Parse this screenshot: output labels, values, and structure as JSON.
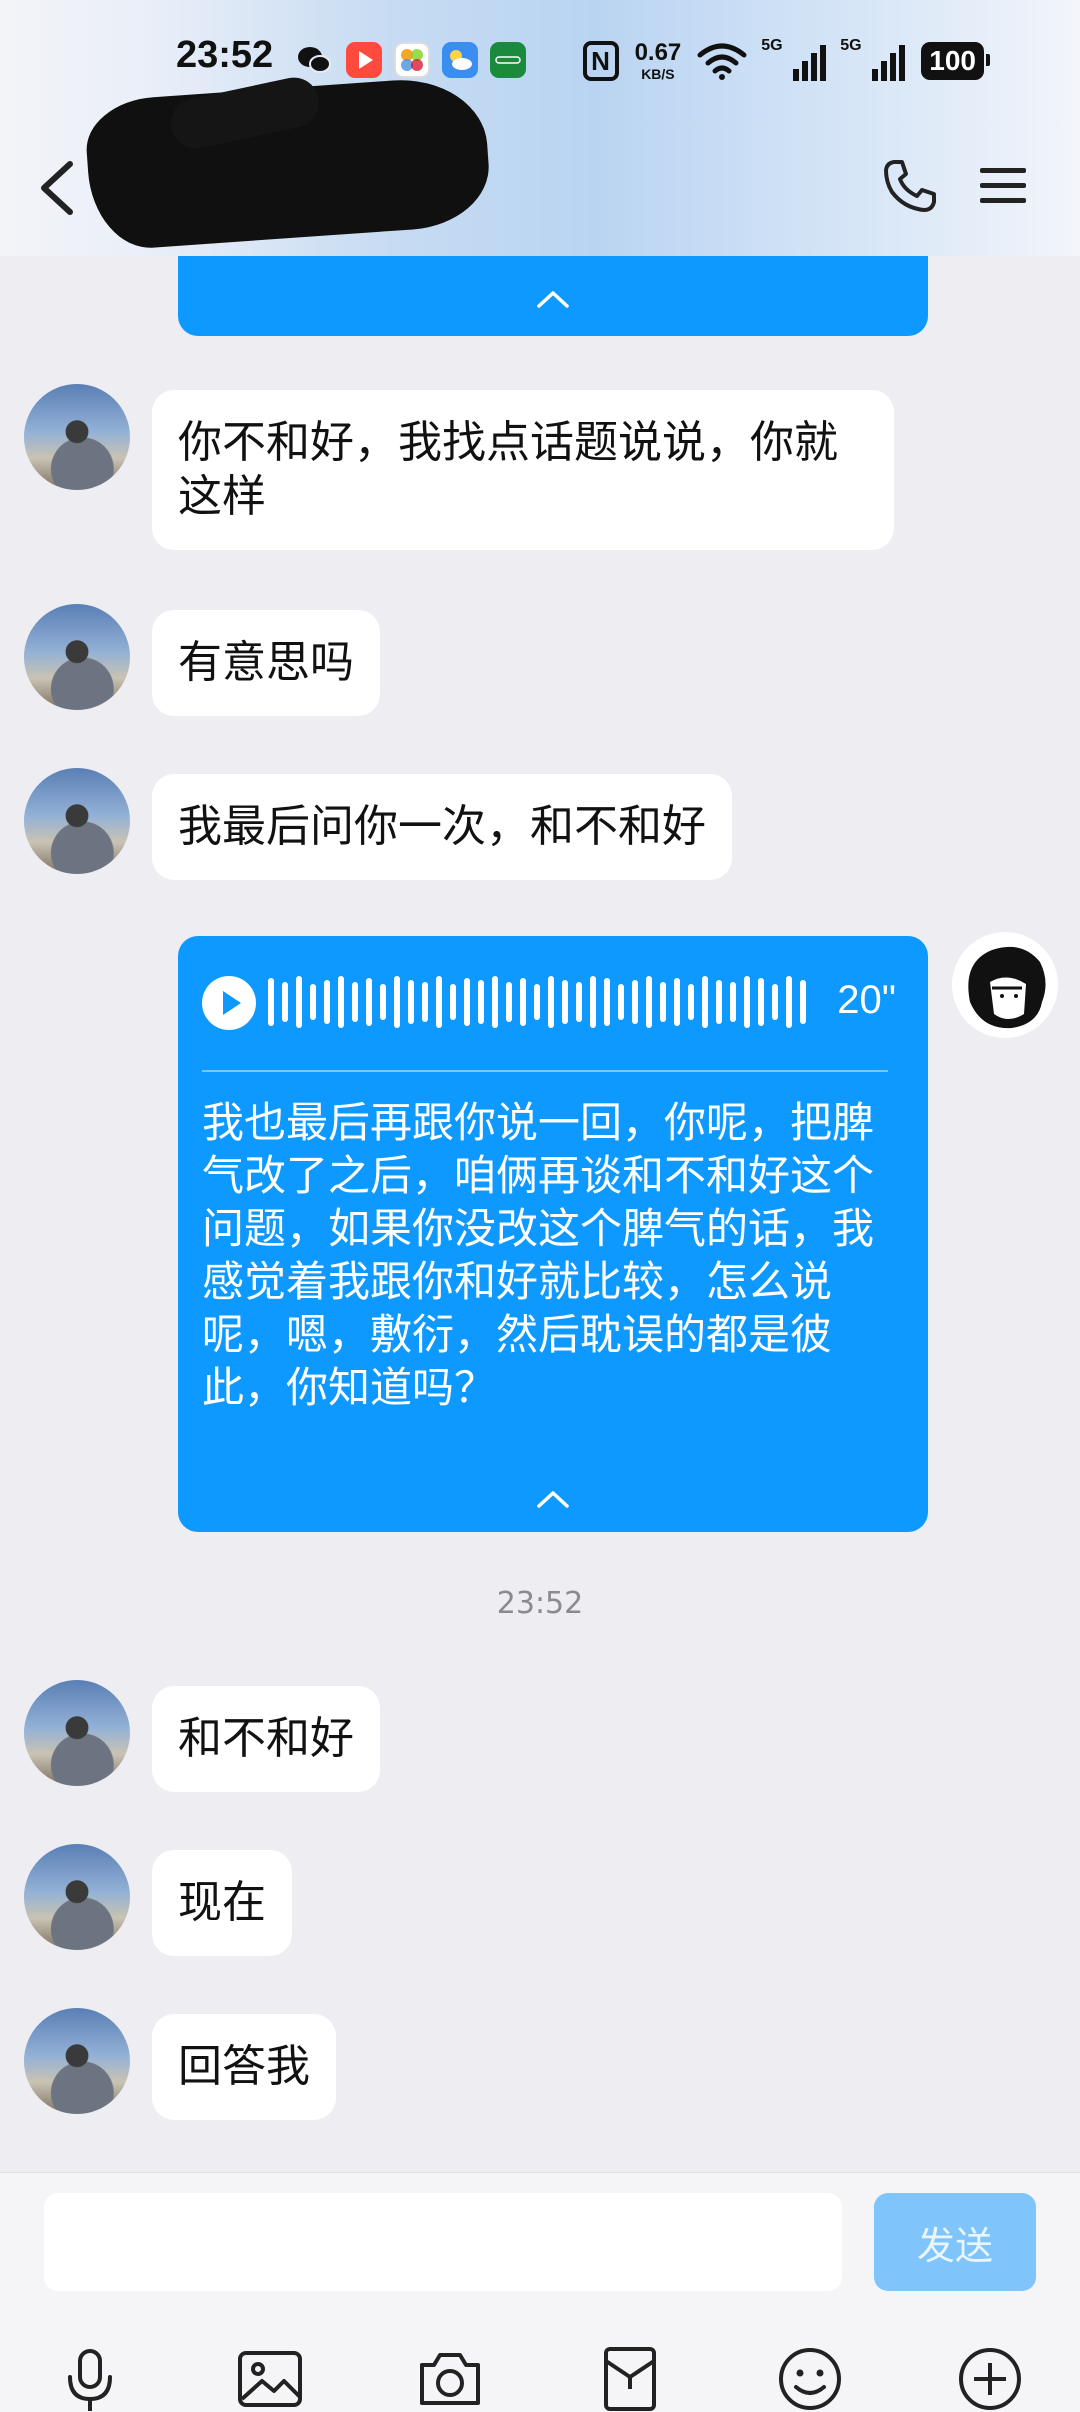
{
  "status_bar": {
    "time": "23:52",
    "network_speed": "0.67",
    "network_speed_unit": "KB/S",
    "signal_label_1": "5G",
    "signal_label_2": "5G",
    "battery": "100",
    "nfc_label": "N"
  },
  "header": {
    "back_icon": "chevron-left-icon",
    "call_icon": "phone-icon",
    "menu_icon": "menu-icon"
  },
  "messages": [
    {
      "side": "left",
      "text": "你不和好，我找点话题说说，你就这样"
    },
    {
      "side": "left",
      "text": "有意思吗"
    },
    {
      "side": "left",
      "text": "我最后问你一次，和不和好"
    },
    {
      "side": "right",
      "type": "voice",
      "duration": "20\"",
      "transcript": "我也最后再跟你说一回，你呢，把脾气改了之后，咱俩再谈和不和好这个问题，如果你没改这个脾气的话，我感觉着我跟你和好就比较，怎么说呢，嗯，敷衍，然后耽误的都是彼此，你知道吗？"
    },
    {
      "side": "left",
      "text": "和不和好"
    },
    {
      "side": "left",
      "text": "现在"
    },
    {
      "side": "left",
      "text": "回答我"
    }
  ],
  "timestamp": "23:52",
  "input": {
    "value": "",
    "send_label": "发送"
  },
  "toolbar": [
    "microphone-icon",
    "image-icon",
    "camera-icon",
    "red-packet-icon",
    "emoji-icon",
    "plus-icon"
  ],
  "colors": {
    "accent": "#0d99ff",
    "send_disabled": "#7fc4fb",
    "background": "#ededf2"
  }
}
